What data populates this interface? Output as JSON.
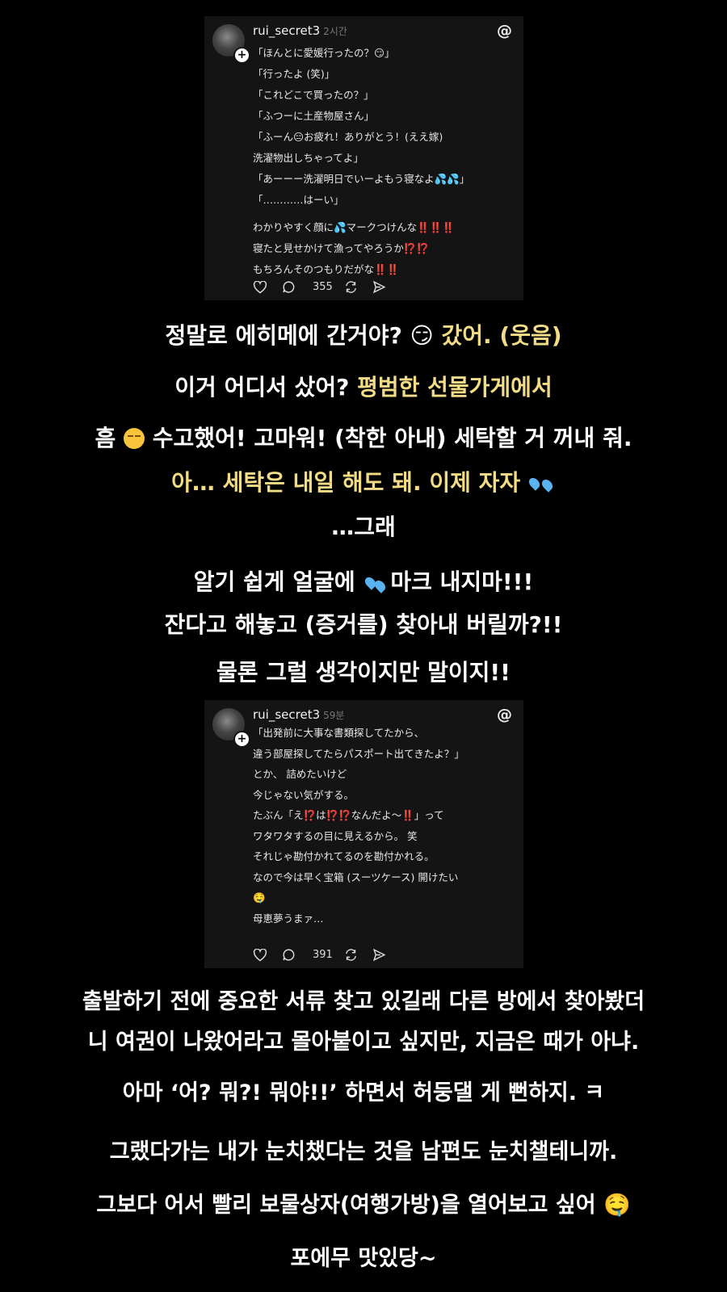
{
  "post1": {
    "username": "rui_secret3",
    "time": "2시간",
    "lines": [
      "「ほんとに愛媛行ったの？😏」",
      "「行ったよ (笑)」",
      "「これどこで買ったの？」",
      "「ふつーに土産物屋さん」",
      "「ふーん😑お疲れ！ありがとう！(ええ嫁)",
      "洗濯物出しちゃってよ」",
      "「あーーー洗濯明日でいーよもう寝なよ💦💦」",
      "「…………はーい」",
      "",
      "わかりやすく顔に💦マークつけんな‼️‼️‼️",
      "寝たと見せかけて漁ってやろうか⁉️⁉️",
      "もちろんそのつもりだがな‼️‼️"
    ],
    "comments": "355"
  },
  "captions1": {
    "l1a": "정말로 에히메에 간거야? 😏 ",
    "l1b": "갔어. (웃음)",
    "l2a": "이거 어디서 샀어? ",
    "l2b": "평범한 선물가게에서",
    "l3a": "흠 ",
    "l3b": " 수고했어! 고마워! (착한 아내) 세탁할 거 꺼내 줘.",
    "l4": "아… 세탁은 내일 해도 돼. 이제 자자 ",
    "l5": "…그래",
    "l6a": "알기 쉽게 얼굴에 ",
    "l6b": "마크 내지마!!!",
    "l7": "잔다고 해놓고 (증거를) 찾아내 버릴까?!!",
    "l8": "물론 그럴 생각이지만 말이지!!"
  },
  "post2": {
    "username": "rui_secret3",
    "time": "59분",
    "lines": [
      "「出発前に大事な書類探してたから、",
      "違う部屋探してたらパスポート出てきたよ？」",
      "とか、 詰めたいけど",
      "今じゃない気がする。",
      "たぶん「え⁉️は⁉️⁉️なんだよ～‼️」って",
      "ワタワタするの目に見えるから。 笑",
      "それじゃ勘付かれてるのを勘付かれる。",
      "なので今は早く宝箱 (スーツケース) 開けたい",
      "🤤",
      "母恵夢うまァ…"
    ],
    "comments": "391"
  },
  "captions2": {
    "l1": "출발하기 전에 중요한 서류 찾고 있길래 다른 방에서 찾아봤더",
    "l2": "니 여권이 나왔어라고 몰아붙이고 싶지만, 지금은 때가 아냐.",
    "l3": "아마 ‘어? 뭐?! 뭐야!!’ 하면서 허둥댈 게 뻔하지. ㅋ",
    "l4": "그랬다가는 내가 눈치챘다는 것을 남편도 눈치챌테니까.",
    "l5": "그보다 어서 빨리 보물상자(여행가방)을 열어보고 싶어 🤤",
    "l6": "포에무 맛있당~"
  },
  "icons": [
    "threads-icon",
    "heart-icon",
    "comment-icon",
    "repost-icon",
    "share-icon",
    "plus-icon"
  ],
  "colors": {
    "highlight": "#f3dc86",
    "background": "#000000",
    "card": "#141414"
  }
}
